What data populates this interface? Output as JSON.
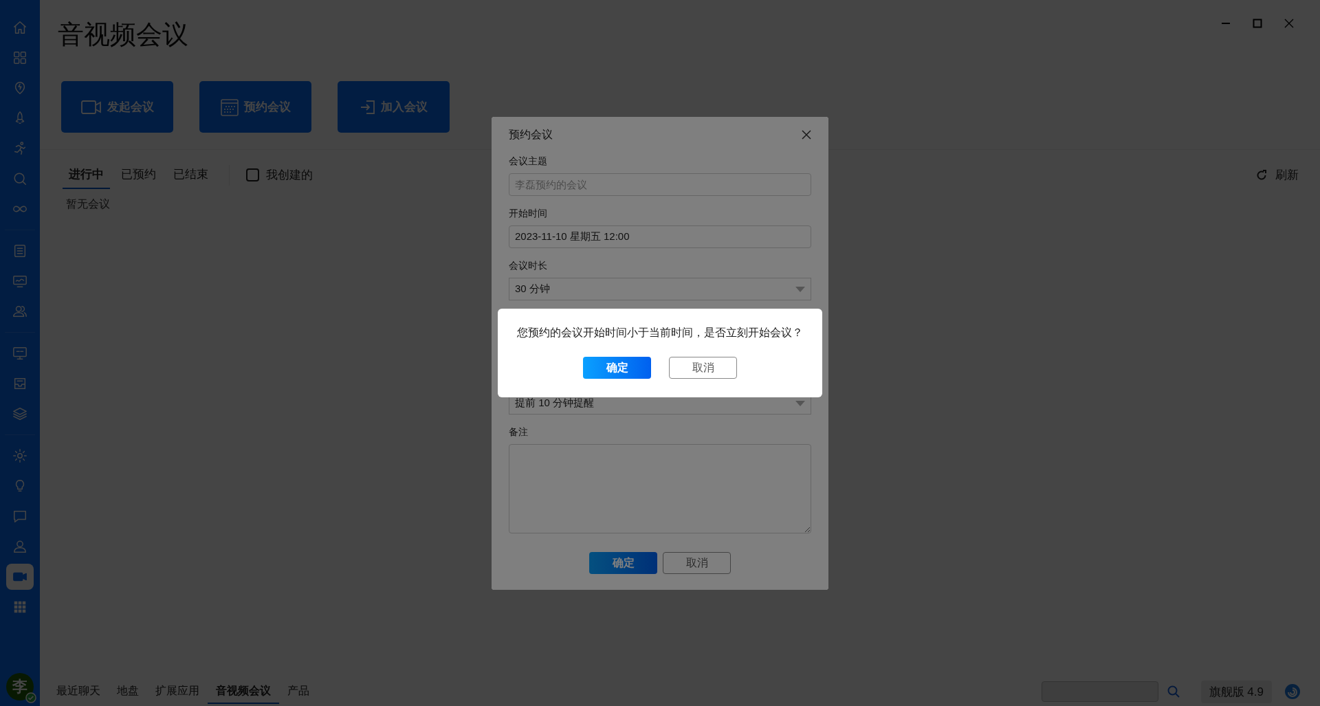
{
  "sidebar": {
    "groups": [
      [
        {
          "kind": "home",
          "selected": false
        },
        {
          "kind": "grid",
          "selected": false
        },
        {
          "kind": "pin",
          "selected": false
        },
        {
          "kind": "rocket",
          "selected": false
        },
        {
          "kind": "runner",
          "selected": false
        },
        {
          "kind": "search",
          "selected": false
        },
        {
          "kind": "infinity",
          "selected": false
        }
      ],
      [
        {
          "kind": "list",
          "selected": false
        },
        {
          "kind": "monitor",
          "selected": false
        },
        {
          "kind": "users",
          "selected": false
        }
      ],
      [
        {
          "kind": "qa",
          "selected": false
        },
        {
          "kind": "inbox",
          "selected": false
        },
        {
          "kind": "layers",
          "selected": false
        }
      ],
      [
        {
          "kind": "gear",
          "selected": false
        },
        {
          "kind": "bulb",
          "selected": false
        },
        {
          "kind": "chat",
          "selected": false
        },
        {
          "kind": "person",
          "selected": false
        },
        {
          "kind": "video",
          "selected": true
        },
        {
          "kind": "apps",
          "selected": false
        }
      ]
    ],
    "avatar": "李"
  },
  "title": "音视频会议",
  "actions": [
    {
      "kind": "video",
      "label": "发起会议"
    },
    {
      "kind": "calendar",
      "label": "预约会议"
    },
    {
      "kind": "join",
      "label": "加入会议"
    }
  ],
  "tabs": [
    {
      "label": "进行中",
      "selected": true
    },
    {
      "label": "已预约",
      "selected": false
    },
    {
      "label": "已结束",
      "selected": false
    }
  ],
  "filter": {
    "label": "我创建的",
    "checked": false
  },
  "refresh": "刷新",
  "empty": "暂无会议",
  "dialog": {
    "title": "预约会议",
    "fields": [
      {
        "kind": "text",
        "label": "会议主题",
        "placeholder": "李磊预约的会议"
      },
      {
        "kind": "text",
        "label": "开始时间",
        "value": "2023-11-10 星期五 12:00"
      },
      {
        "kind": "select",
        "label": "会议时长",
        "value": "30 分钟"
      },
      {
        "kind": "select",
        "value": "提前 10 分钟提醒"
      },
      {
        "kind": "textarea",
        "label": "备注"
      }
    ],
    "buttons": [
      {
        "kind": "primary",
        "label": "确定"
      },
      {
        "kind": "default",
        "label": "取消"
      }
    ]
  },
  "alert": {
    "message": "您预约的会议开始时间小于当前时间，是否立刻开始会议？",
    "buttons": [
      {
        "kind": "primary",
        "label": "确定"
      },
      {
        "kind": "default",
        "label": "取消"
      }
    ]
  },
  "bottom_nav": [
    {
      "label": "最近聊天",
      "selected": false
    },
    {
      "label": "地盘",
      "selected": false
    },
    {
      "label": "扩展应用",
      "selected": false
    },
    {
      "label": "音视频会议",
      "selected": true
    },
    {
      "label": "产品",
      "selected": false
    }
  ],
  "edition": "旗舰版 4.9"
}
